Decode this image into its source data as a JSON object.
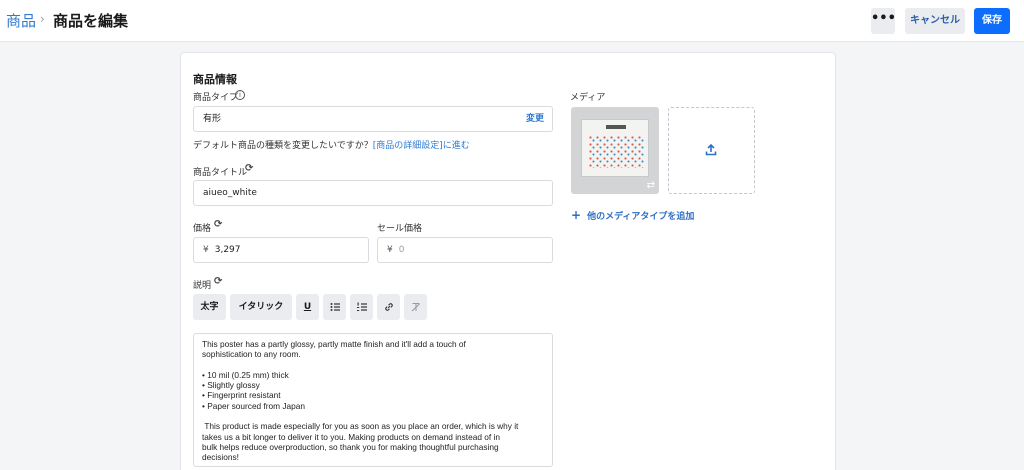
{
  "header": {
    "breadcrumb_root": "商品",
    "breadcrumb_sep": "›",
    "title": "商品を編集",
    "more_label": "•••",
    "cancel_label": "キャンセル",
    "save_label": "保存"
  },
  "form": {
    "section_title": "商品情報",
    "product_type": {
      "label": "商品タイプ",
      "value": "有形",
      "change_label": "変更",
      "hint": "デフォルト商品の種類を変更したいですか？",
      "hint_link": "[商品の詳細設定]に進む"
    },
    "product_title": {
      "label": "商品タイトル",
      "value": "aiueo_white"
    },
    "price": {
      "label": "価格",
      "currency": "¥",
      "value": "3,297"
    },
    "sale_price": {
      "label": "セール価格",
      "currency": "¥",
      "placeholder": "0"
    },
    "description": {
      "label": "説明",
      "toolbar": {
        "bold": "太字",
        "italic": "イタリック",
        "underline": "U"
      },
      "text": "This poster has a partly glossy, partly matte finish and it'll add a touch of\nsophistication to any room.\n\n• 10 mil (0.25 mm) thick\n• Slightly glossy\n• Fingerprint resistant\n• Paper sourced from Japan\n\n This product is made especially for you as soon as you place an order, which is why it\ntakes us a bit longer to deliver it to you. Making products on demand instead of in\nbulk helps reduce overproduction, so thank you for making thoughtful purchasing\ndecisions!"
    }
  },
  "media": {
    "label": "メディア",
    "add_media_label": "他のメディアタイプを追加"
  },
  "colors": {
    "accent": "#0d6efd",
    "link": "#2f7bd4"
  }
}
